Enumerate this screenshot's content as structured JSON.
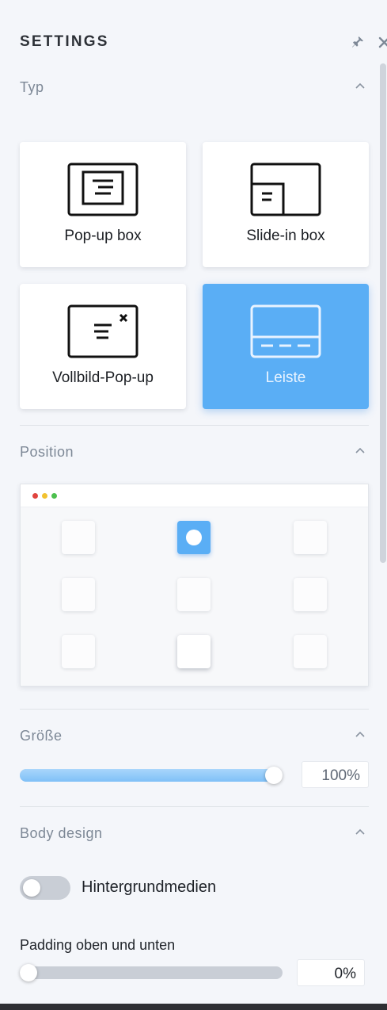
{
  "header": {
    "title": "SETTINGS",
    "pin_icon": "pin-icon",
    "close_icon": "close-icon"
  },
  "sections": {
    "typ": "Typ",
    "position": "Position",
    "groesse": "Größe",
    "body_design": "Body design"
  },
  "type_cards": [
    {
      "label": "Pop-up box",
      "icon": "popup-box-icon",
      "active": false
    },
    {
      "label": "Slide-in box",
      "icon": "slide-in-box-icon",
      "active": false
    },
    {
      "label": "Vollbild-Pop-up",
      "icon": "fullscreen-popup-icon",
      "active": false
    },
    {
      "label": "Leiste",
      "icon": "bar-icon",
      "active": true
    }
  ],
  "position_grid": {
    "selected": "top-center",
    "window_dots": [
      "#e0443e",
      "#f2c230",
      "#4cc04e"
    ]
  },
  "size": {
    "value_text": "100%",
    "value": 100
  },
  "body_design": {
    "background_media_label": "Hintergrundmedien",
    "background_media_enabled": false,
    "padding_label": "Padding oben und unten",
    "padding_value_text": "0%",
    "padding_value": 0
  },
  "colors": {
    "accent": "#5aaef5",
    "section_title": "#7d8896"
  }
}
